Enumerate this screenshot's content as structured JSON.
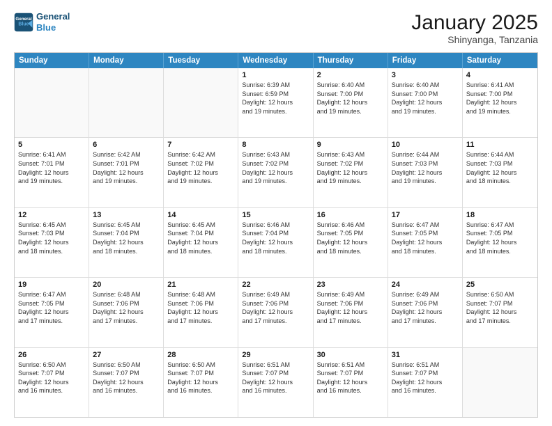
{
  "header": {
    "logo_line1": "General",
    "logo_line2": "Blue",
    "month_title": "January 2025",
    "location": "Shinyanga, Tanzania"
  },
  "weekdays": [
    "Sunday",
    "Monday",
    "Tuesday",
    "Wednesday",
    "Thursday",
    "Friday",
    "Saturday"
  ],
  "rows": [
    [
      {
        "day": "",
        "text": ""
      },
      {
        "day": "",
        "text": ""
      },
      {
        "day": "",
        "text": ""
      },
      {
        "day": "1",
        "text": "Sunrise: 6:39 AM\nSunset: 6:59 PM\nDaylight: 12 hours\nand 19 minutes."
      },
      {
        "day": "2",
        "text": "Sunrise: 6:40 AM\nSunset: 7:00 PM\nDaylight: 12 hours\nand 19 minutes."
      },
      {
        "day": "3",
        "text": "Sunrise: 6:40 AM\nSunset: 7:00 PM\nDaylight: 12 hours\nand 19 minutes."
      },
      {
        "day": "4",
        "text": "Sunrise: 6:41 AM\nSunset: 7:00 PM\nDaylight: 12 hours\nand 19 minutes."
      }
    ],
    [
      {
        "day": "5",
        "text": "Sunrise: 6:41 AM\nSunset: 7:01 PM\nDaylight: 12 hours\nand 19 minutes."
      },
      {
        "day": "6",
        "text": "Sunrise: 6:42 AM\nSunset: 7:01 PM\nDaylight: 12 hours\nand 19 minutes."
      },
      {
        "day": "7",
        "text": "Sunrise: 6:42 AM\nSunset: 7:02 PM\nDaylight: 12 hours\nand 19 minutes."
      },
      {
        "day": "8",
        "text": "Sunrise: 6:43 AM\nSunset: 7:02 PM\nDaylight: 12 hours\nand 19 minutes."
      },
      {
        "day": "9",
        "text": "Sunrise: 6:43 AM\nSunset: 7:02 PM\nDaylight: 12 hours\nand 19 minutes."
      },
      {
        "day": "10",
        "text": "Sunrise: 6:44 AM\nSunset: 7:03 PM\nDaylight: 12 hours\nand 19 minutes."
      },
      {
        "day": "11",
        "text": "Sunrise: 6:44 AM\nSunset: 7:03 PM\nDaylight: 12 hours\nand 18 minutes."
      }
    ],
    [
      {
        "day": "12",
        "text": "Sunrise: 6:45 AM\nSunset: 7:03 PM\nDaylight: 12 hours\nand 18 minutes."
      },
      {
        "day": "13",
        "text": "Sunrise: 6:45 AM\nSunset: 7:04 PM\nDaylight: 12 hours\nand 18 minutes."
      },
      {
        "day": "14",
        "text": "Sunrise: 6:45 AM\nSunset: 7:04 PM\nDaylight: 12 hours\nand 18 minutes."
      },
      {
        "day": "15",
        "text": "Sunrise: 6:46 AM\nSunset: 7:04 PM\nDaylight: 12 hours\nand 18 minutes."
      },
      {
        "day": "16",
        "text": "Sunrise: 6:46 AM\nSunset: 7:05 PM\nDaylight: 12 hours\nand 18 minutes."
      },
      {
        "day": "17",
        "text": "Sunrise: 6:47 AM\nSunset: 7:05 PM\nDaylight: 12 hours\nand 18 minutes."
      },
      {
        "day": "18",
        "text": "Sunrise: 6:47 AM\nSunset: 7:05 PM\nDaylight: 12 hours\nand 18 minutes."
      }
    ],
    [
      {
        "day": "19",
        "text": "Sunrise: 6:47 AM\nSunset: 7:05 PM\nDaylight: 12 hours\nand 17 minutes."
      },
      {
        "day": "20",
        "text": "Sunrise: 6:48 AM\nSunset: 7:06 PM\nDaylight: 12 hours\nand 17 minutes."
      },
      {
        "day": "21",
        "text": "Sunrise: 6:48 AM\nSunset: 7:06 PM\nDaylight: 12 hours\nand 17 minutes."
      },
      {
        "day": "22",
        "text": "Sunrise: 6:49 AM\nSunset: 7:06 PM\nDaylight: 12 hours\nand 17 minutes."
      },
      {
        "day": "23",
        "text": "Sunrise: 6:49 AM\nSunset: 7:06 PM\nDaylight: 12 hours\nand 17 minutes."
      },
      {
        "day": "24",
        "text": "Sunrise: 6:49 AM\nSunset: 7:06 PM\nDaylight: 12 hours\nand 17 minutes."
      },
      {
        "day": "25",
        "text": "Sunrise: 6:50 AM\nSunset: 7:07 PM\nDaylight: 12 hours\nand 17 minutes."
      }
    ],
    [
      {
        "day": "26",
        "text": "Sunrise: 6:50 AM\nSunset: 7:07 PM\nDaylight: 12 hours\nand 16 minutes."
      },
      {
        "day": "27",
        "text": "Sunrise: 6:50 AM\nSunset: 7:07 PM\nDaylight: 12 hours\nand 16 minutes."
      },
      {
        "day": "28",
        "text": "Sunrise: 6:50 AM\nSunset: 7:07 PM\nDaylight: 12 hours\nand 16 minutes."
      },
      {
        "day": "29",
        "text": "Sunrise: 6:51 AM\nSunset: 7:07 PM\nDaylight: 12 hours\nand 16 minutes."
      },
      {
        "day": "30",
        "text": "Sunrise: 6:51 AM\nSunset: 7:07 PM\nDaylight: 12 hours\nand 16 minutes."
      },
      {
        "day": "31",
        "text": "Sunrise: 6:51 AM\nSunset: 7:07 PM\nDaylight: 12 hours\nand 16 minutes."
      },
      {
        "day": "",
        "text": ""
      }
    ]
  ]
}
